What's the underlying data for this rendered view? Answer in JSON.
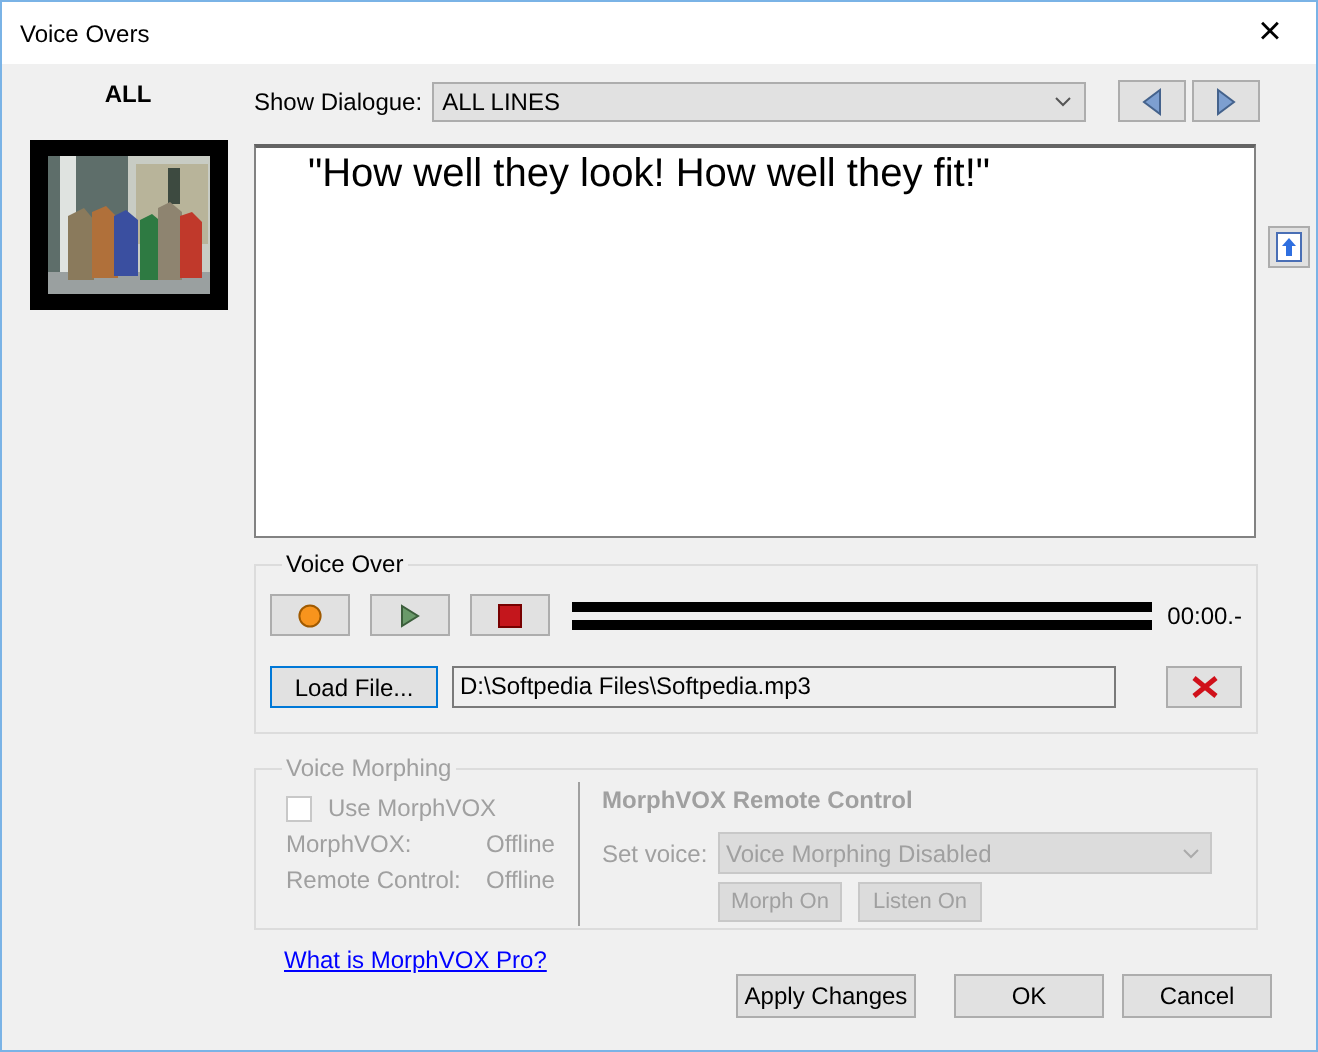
{
  "window": {
    "title": "Voice Overs",
    "close": "×"
  },
  "speaker": {
    "label": "ALL"
  },
  "dialogue_filter": {
    "label": "Show Dialogue:",
    "value": "ALL LINES"
  },
  "dialogue_text": "\"How well they look! How well they fit!\"",
  "voice_over": {
    "title": "Voice Over",
    "time": "00:00.-",
    "load_button": "Load File...",
    "file_path": "D:\\Softpedia Files\\Softpedia.mp3"
  },
  "voice_morphing": {
    "title": "Voice Morphing",
    "disabled": true,
    "use_checkbox": {
      "label": "Use MorphVOX",
      "checked": false
    },
    "status": [
      {
        "label": "MorphVOX:",
        "value": "Offline"
      },
      {
        "label": "Remote Control:",
        "value": "Offline"
      }
    ],
    "remote_title": "MorphVOX Remote Control",
    "set_voice_label": "Set voice:",
    "set_voice_value": "Voice Morphing Disabled",
    "buttons": [
      "Morph On",
      "Listen On"
    ]
  },
  "link": "What is MorphVOX Pro?",
  "buttons": [
    "Apply Changes",
    "OK",
    "Cancel"
  ]
}
